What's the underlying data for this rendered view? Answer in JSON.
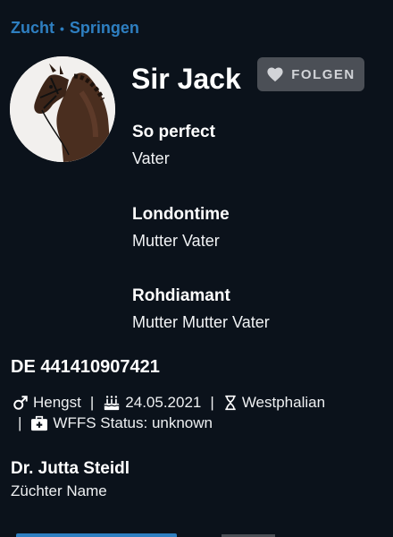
{
  "breadcrumb": {
    "category": "Zucht",
    "separator": "•",
    "discipline": "Springen"
  },
  "horse": {
    "name": "Sir Jack"
  },
  "follow_button": {
    "label": "FOLGEN",
    "icon": "heart-icon"
  },
  "pedigree": [
    {
      "name": "So perfect",
      "relation": "Vater"
    },
    {
      "name": "Londontime",
      "relation": "Mutter Vater"
    },
    {
      "name": "Rohdiamant",
      "relation": "Mutter Mutter Vater"
    }
  ],
  "registration": "DE 441410907421",
  "details": {
    "sex": "Hengst",
    "birthdate": "24.05.2021",
    "breed": "Westphalian",
    "wffs": "WFFS Status: unknown",
    "separator": "|"
  },
  "breeder": {
    "name": "Dr. Jutta Steidl",
    "label": "Züchter Name"
  },
  "colors": {
    "accent": "#2e7fc1",
    "background": "#0b121b",
    "button": "#4b4f56"
  }
}
